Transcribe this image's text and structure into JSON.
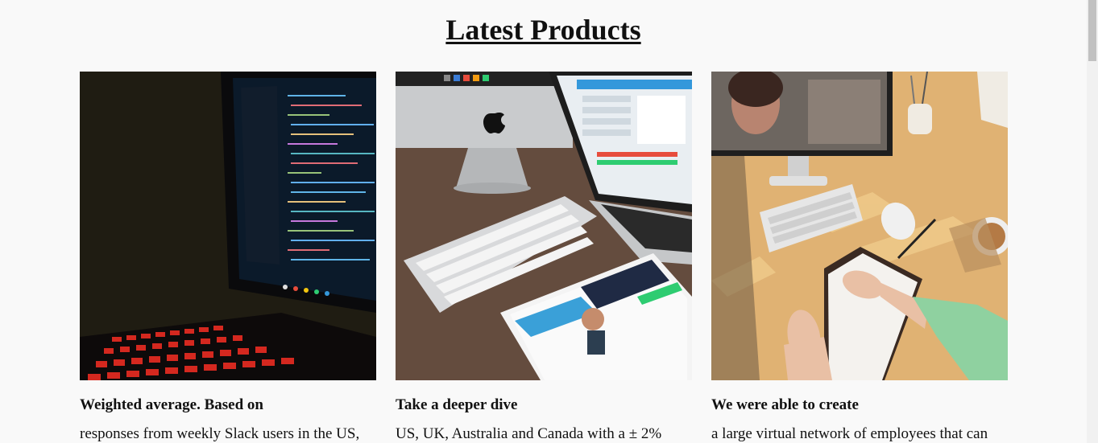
{
  "section": {
    "title": "Latest Products"
  },
  "products": [
    {
      "image": "laptop-code-photo",
      "heading": "Weighted average. Based on",
      "description": "responses from weekly Slack users in the US,"
    },
    {
      "image": "apple-devices-desk-photo",
      "heading": "Take a deeper dive",
      "description": "US, UK, Australia and Canada with a ± 2%"
    },
    {
      "image": "video-call-desk-photo",
      "heading": "We were able to create",
      "description": "a large virtual network of employees that can"
    }
  ],
  "colors": {
    "background": "#f9f9f9",
    "text": "#111111"
  }
}
